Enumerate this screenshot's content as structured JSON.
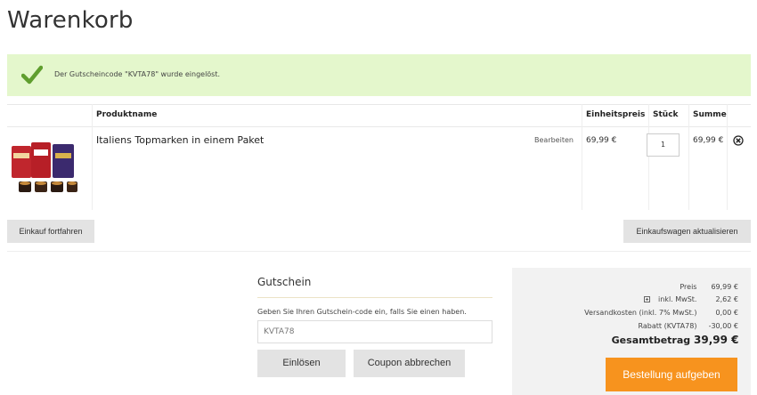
{
  "page": {
    "title": "Warenkorb"
  },
  "alert": {
    "message": "Der Gutscheincode \"KVTA78\" wurde eingelöst.",
    "color": "#e4f7cc",
    "icon": "checkmark-icon"
  },
  "cart": {
    "headers": {
      "product": "Produktname",
      "unit_price": "Einheitspreis",
      "qty": "Stück",
      "sum": "Summe"
    },
    "items": [
      {
        "name": "Italiens Topmarken in einem Paket",
        "edit": "Bearbeiten",
        "unit_price": "69,99 €",
        "qty": "1",
        "sum": "69,99 €",
        "remove_icon": "remove-icon"
      }
    ]
  },
  "actions": {
    "continue": "Einkauf fortfahren",
    "update": "Einkaufswagen aktualisieren"
  },
  "coupon": {
    "title": "Gutschein",
    "hint": "Geben Sie Ihren Gutschein-code ein, falls Sie einen haben.",
    "value": "KVTA78",
    "redeem": "Einlösen",
    "cancel": "Coupon abbrechen"
  },
  "summary": {
    "price_label": "Preis",
    "price_value": "69,99 €",
    "vat_label": "inkl. MwSt.",
    "vat_value": "2,62 €",
    "shipping_label": "Versandkosten (inkl. 7% MwSt.)",
    "shipping_value": "0,00 €",
    "discount_label": "Rabatt (KVTA78)",
    "discount_value": "-30,00 €",
    "total_label": "Gesamtbetrag",
    "total_value": "39,99 €",
    "order_button": "Bestellung aufgeben",
    "accent_color": "#f7931e"
  }
}
